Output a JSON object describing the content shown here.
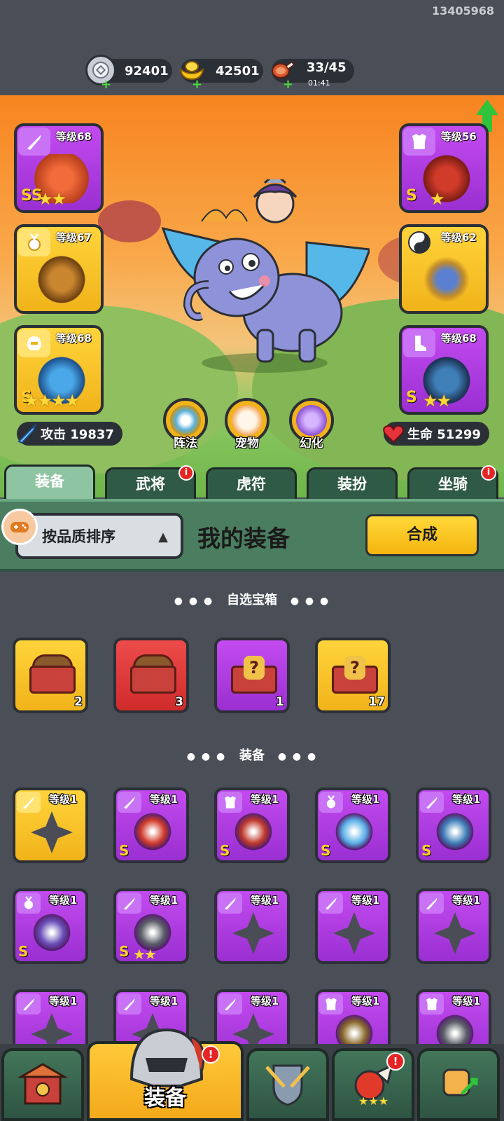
{
  "header": {
    "user_id": "13405968",
    "resources": [
      {
        "name": "silver-coin",
        "value": "92401",
        "sub": ""
      },
      {
        "name": "gold-ingot",
        "value": "42501",
        "sub": ""
      },
      {
        "name": "meat-stamina",
        "value": "33/45",
        "sub": "01:41"
      }
    ]
  },
  "equipped": {
    "left": [
      {
        "level": "等级68",
        "type_icon": "sword-icon",
        "grade": "SS",
        "stars": "★★",
        "rarity": "purple"
      },
      {
        "level": "等级67",
        "type_icon": "medal-icon",
        "grade": "",
        "stars": "",
        "rarity": "gold"
      },
      {
        "level": "等级68",
        "type_icon": "helmet-icon",
        "grade": "S",
        "stars": "★★★★",
        "rarity": "gold"
      }
    ],
    "right": [
      {
        "level": "等级56",
        "type_icon": "armor-icon",
        "grade": "S",
        "stars": "★",
        "rarity": "purple"
      },
      {
        "level": "等级62",
        "type_icon": "yinyang-icon",
        "grade": "",
        "stars": "",
        "rarity": "gold"
      },
      {
        "level": "等级68",
        "type_icon": "boot-icon",
        "grade": "S",
        "stars": "★★",
        "rarity": "purple"
      }
    ]
  },
  "stats": {
    "attack": "攻击 19837",
    "hp": "生命 51299"
  },
  "circle_buttons": [
    "阵法",
    "宠物",
    "幻化"
  ],
  "tabs": [
    "装备",
    "武将",
    "虎符",
    "装扮",
    "坐骑"
  ],
  "panel": {
    "sort_label": "按品质排序",
    "sort_icon": "▲",
    "title": "我的装备",
    "synth_label": "合成"
  },
  "section_chest": "自选宝箱",
  "section_equip": "装备",
  "section_dots_left": "● ● ●",
  "section_dots_right": "● ● ●",
  "chests": [
    {
      "count": "2",
      "rarity": "gold"
    },
    {
      "count": "3",
      "rarity": "red"
    },
    {
      "count": "1",
      "rarity": "purple"
    },
    {
      "count": "17",
      "rarity": "gold"
    }
  ],
  "equipment": [
    {
      "level": "等级1",
      "type_icon": "sword-icon",
      "grade": "",
      "stars": "",
      "rarity": "gold"
    },
    {
      "level": "等级1",
      "type_icon": "sword-icon",
      "grade": "S",
      "stars": "",
      "rarity": "purple"
    },
    {
      "level": "等级1",
      "type_icon": "armor-icon",
      "grade": "S",
      "stars": "",
      "rarity": "purple"
    },
    {
      "level": "等级1",
      "type_icon": "medal-icon",
      "grade": "S",
      "stars": "",
      "rarity": "purple"
    },
    {
      "level": "等级1",
      "type_icon": "sword-icon",
      "grade": "S",
      "stars": "",
      "rarity": "purple"
    },
    {
      "level": "等级1",
      "type_icon": "medal-icon",
      "grade": "S",
      "stars": "",
      "rarity": "purple"
    },
    {
      "level": "等级1",
      "type_icon": "sword-icon",
      "grade": "S",
      "stars": "★★",
      "rarity": "purple"
    },
    {
      "level": "等级1",
      "type_icon": "sword-icon",
      "grade": "",
      "stars": "",
      "rarity": "purple"
    },
    {
      "level": "等级1",
      "type_icon": "sword-icon",
      "grade": "",
      "stars": "",
      "rarity": "purple"
    },
    {
      "level": "等级1",
      "type_icon": "sword-icon",
      "grade": "",
      "stars": "",
      "rarity": "purple"
    },
    {
      "level": "等级1",
      "type_icon": "sword-icon",
      "grade": "",
      "stars": "",
      "rarity": "purple"
    },
    {
      "level": "等级1",
      "type_icon": "sword-icon",
      "grade": "",
      "stars": "",
      "rarity": "purple"
    },
    {
      "level": "等级1",
      "type_icon": "sword-icon",
      "grade": "",
      "stars": "",
      "rarity": "purple"
    },
    {
      "level": "等级1",
      "type_icon": "armor-icon",
      "grade": "",
      "stars": "",
      "rarity": "purple"
    },
    {
      "level": "等级1",
      "type_icon": "armor-icon",
      "grade": "",
      "stars": "",
      "rarity": "purple"
    }
  ],
  "bottom_nav": [
    {
      "label": "",
      "icon": "gate-icon",
      "badge": ""
    },
    {
      "label": "装备",
      "icon": "helmet-icon",
      "badge": "!"
    },
    {
      "label": "",
      "icon": "sword-shield-icon",
      "badge": ""
    },
    {
      "label": "",
      "icon": "pet-icon",
      "badge": "!"
    },
    {
      "label": "",
      "icon": "fist-icon",
      "badge": ""
    }
  ],
  "tab_badges": {
    "武将": "i",
    "坐骑": "i"
  },
  "colors": {
    "purple": "#b23fe4",
    "gold": "#f7c22a",
    "red": "#dd3a3a",
    "panel_green": "#4b7e60",
    "background": "#4a4f57"
  }
}
